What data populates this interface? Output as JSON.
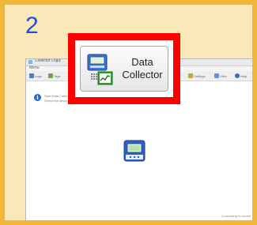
{
  "step_number": "2",
  "highlighted_button": {
    "line1": "Data",
    "line2": "Collector",
    "icon": "data-collector-icon"
  },
  "app": {
    "title": "Collector Logic",
    "menu": "Menu",
    "toolbar": [
      {
        "label": "Logs",
        "icon": "folder-icon",
        "color": "#4a7fc1"
      },
      {
        "label": "Tags",
        "icon": "tag-icon",
        "color": "#6aa84f"
      },
      {
        "label": "Settings",
        "icon": "settings-icon",
        "color": "#c9a23a"
      },
      {
        "label": "View",
        "icon": "view-icon",
        "color": "#6b8fd6"
      },
      {
        "label": "Help",
        "icon": "help-icon",
        "color": "#3d6fb6"
      }
    ],
    "message_line1": "Start Data Collector",
    "message_line2": "Select the device",
    "status": "Connecting to device"
  },
  "colors": {
    "background": "#fbe8b8",
    "border": "#f2b63a",
    "step_number": "#1f4fd8",
    "highlight": "#ff0000"
  }
}
